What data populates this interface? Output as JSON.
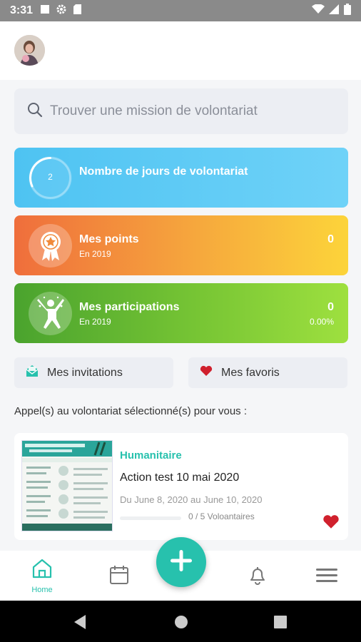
{
  "status_bar": {
    "time": "3:31"
  },
  "search": {
    "placeholder": "Trouver une mission de volontariat"
  },
  "cards": {
    "days": {
      "title": "Nombre de jours de volontariat",
      "count": "2"
    },
    "points": {
      "title": "Mes points",
      "subtitle": "En 2019",
      "value": "0"
    },
    "participations": {
      "title": "Mes participations",
      "subtitle": "En 2019",
      "value": "0",
      "percent": "0.00%"
    }
  },
  "quick_links": {
    "invitations": "Mes invitations",
    "favorites": "Mes favoris"
  },
  "section": {
    "title": "Appel(s) au volontariat sélectionné(s) pour vous :"
  },
  "mission": {
    "category": "Humanitaire",
    "title": "Action test 10 mai 2020",
    "dates": "Du June 8, 2020 au June 10, 2020",
    "volunteers": "0 / 5 Voloantaires",
    "progress": 0,
    "favorited": true
  },
  "bottom_nav": {
    "home": "Home"
  },
  "colors": {
    "accent": "#27c1ad",
    "heart": "#d0202d",
    "blue": "#4ec3f2",
    "orange": "#f08a3a",
    "green": "#5fb52f"
  }
}
